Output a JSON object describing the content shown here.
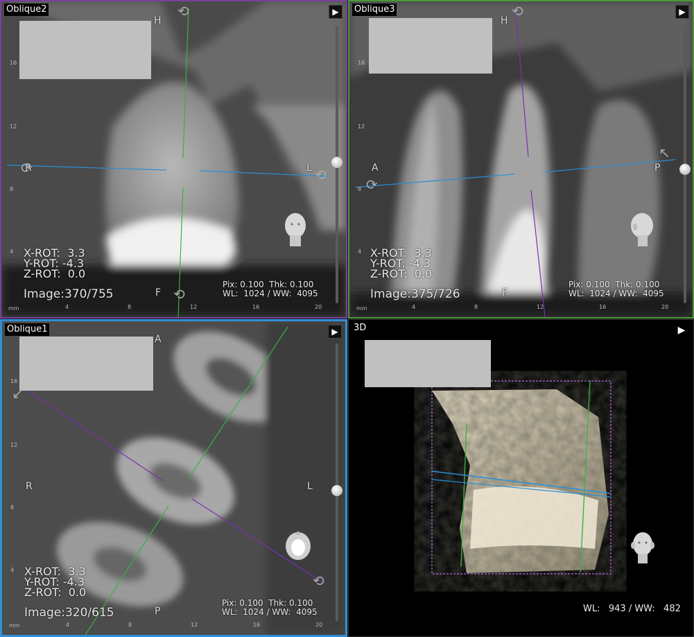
{
  "viewports": {
    "oblique2": {
      "title": "Oblique2",
      "orient": {
        "top": "H",
        "bottom": "F",
        "left": "R",
        "right": "L"
      },
      "xrot": "X-ROT:  3.3",
      "yrot": "Y-ROT: -4.3",
      "zrot": "Z-ROT:  0.0",
      "image": "Image:370/755",
      "pix": "Pix: 0.100  Thk: 0.100",
      "wlww": "WL:  1024 / WW:  4095",
      "ruler_left": [
        "16",
        "12",
        "8",
        "4",
        "mm"
      ],
      "ruler_bottom": [
        "4",
        "8",
        "12",
        "16",
        "20"
      ],
      "slider_value": 0.5
    },
    "oblique3": {
      "title": "Oblique3",
      "orient": {
        "top": "H",
        "bottom": "F",
        "left": "A",
        "right": "P"
      },
      "xrot": "X-ROT:  3.3",
      "yrot": "Y-ROT: -4.3",
      "zrot": "Z-ROT:  0.0",
      "image": "Image:375/726",
      "pix": "Pix: 0.100  Thk: 0.100",
      "wlww": "WL:  1024 / WW:  4095",
      "ruler_left": [
        "16",
        "12",
        "8",
        "4",
        "mm"
      ],
      "ruler_bottom": [
        "4",
        "8",
        "12",
        "16",
        "20"
      ],
      "slider_value": 0.5
    },
    "oblique1": {
      "title": "Oblique1",
      "orient": {
        "top": "A",
        "bottom": "P",
        "left": "R",
        "right": "L"
      },
      "xrot": "X-ROT:  3.3",
      "yrot": "Y-ROT: -4.3",
      "zrot": "Z-ROT:  0.0",
      "image": "Image:320/615",
      "pix": "Pix: 0.100  Thk: 0.100",
      "wlww": "WL:  1024 / WW:  4095",
      "ruler_left": [
        "16",
        "12",
        "8",
        "4",
        "mm"
      ],
      "ruler_bottom": [
        "4",
        "8",
        "12",
        "16",
        "20"
      ],
      "slider_value": 0.5
    },
    "view3d": {
      "title": "3D",
      "wlww": "WL:   943 / WW:   482"
    }
  },
  "colors": {
    "oblique2_border": "#7b3fa0",
    "oblique3_border": "#4a9a3a",
    "oblique1_border": "#2f8fd8",
    "line_green": "#3cb043",
    "line_blue": "#2a8fd6",
    "line_purple": "#7a2fb8",
    "bbox_purple": "#b86be0"
  },
  "icons": {
    "play": "play-icon",
    "rotate": "rotate-arrow-icon",
    "head": "head-orientation-icon"
  }
}
